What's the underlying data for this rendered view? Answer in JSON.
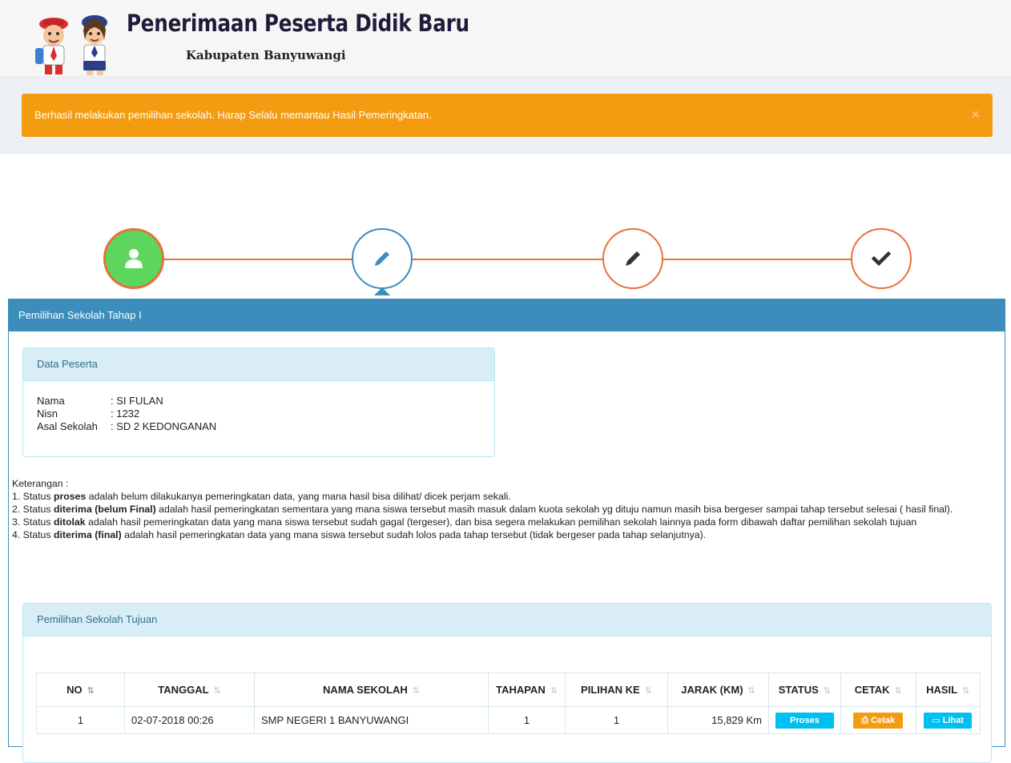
{
  "header": {
    "title": "Penerimaan Peserta Didik Baru",
    "subtitle": "Kabupaten Banyuwangi"
  },
  "alert": {
    "message": "Berhasil melakukan pemilihan sekolah. Harap Selalu memantau Hasil Pemeringkatan.",
    "close": "×"
  },
  "wizard": {
    "steps": [
      {
        "icon": "user-icon",
        "state": "done",
        "color": "#5cd65c"
      },
      {
        "icon": "pencil-icon",
        "state": "active",
        "color": "#3c8dbc"
      },
      {
        "icon": "pencil-icon",
        "state": "pending",
        "color": "#e8703a"
      },
      {
        "icon": "check-icon",
        "state": "pending",
        "color": "#e8703a"
      }
    ]
  },
  "main": {
    "title": "Pemilihan Sekolah Tahap I"
  },
  "data_peserta": {
    "title": "Data Peserta",
    "fields": [
      {
        "label": "Nama",
        "value": ": SI FULAN"
      },
      {
        "label": "Nisn",
        "value": ": 1232"
      },
      {
        "label": "Asal Sekolah",
        "value": ": SD 2 KEDONGANAN"
      }
    ]
  },
  "keterangan": {
    "heading": "Keterangan :",
    "items": [
      {
        "prefix": "1. Status ",
        "bold": "proses",
        "text": " adalah belum dilakukanya pemeringkatan data, yang mana hasil bisa dilihat/ dicek perjam sekali."
      },
      {
        "prefix": "2. Status ",
        "bold": "diterima (belum Final)",
        "text": " adalah hasil pemeringkatan sementara yang mana siswa tersebut masih masuk dalam kuota sekolah yg dituju namun masih bisa bergeser sampai tahap tersebut selesai ( hasil final)."
      },
      {
        "prefix": "3. Status ",
        "bold": "ditolak",
        "text": " adalah hasil pemeringkatan data yang mana siswa tersebut sudah gagal (tergeser), dan bisa segera melakukan pemilihan sekolah lainnya pada form dibawah daftar pemilihan sekolah tujuan"
      },
      {
        "prefix": "4. Status ",
        "bold": "diterima (final)",
        "text": " adalah hasil pemeringkatan data yang mana siswa tersebut sudah lolos pada tahap tersebut (tidak bergeser pada tahap selanjutnya)."
      }
    ]
  },
  "pemilihan": {
    "title": "Pemilihan Sekolah Tujuan",
    "columns": [
      "NO",
      "TANGGAL",
      "NAMA SEKOLAH",
      "TAHAPAN",
      "PILIHAN KE",
      "JARAK (KM)",
      "STATUS",
      "CETAK",
      "HASIL"
    ],
    "rows": [
      {
        "no": "1",
        "tanggal": "02-07-2018 00:26",
        "nama_sekolah": "SMP NEGERI 1 BANYUWANGI",
        "tahapan": "1",
        "pilihan_ke": "1",
        "jarak": "15,829 Km",
        "status": "Proses",
        "cetak": "Cetak",
        "hasil": "Lihat"
      }
    ]
  },
  "colors": {
    "accent": "#3c8dbc",
    "warning": "#f39c12",
    "info": "#00c0ef",
    "success": "#5cd65c",
    "step_line": "#e8703a"
  }
}
